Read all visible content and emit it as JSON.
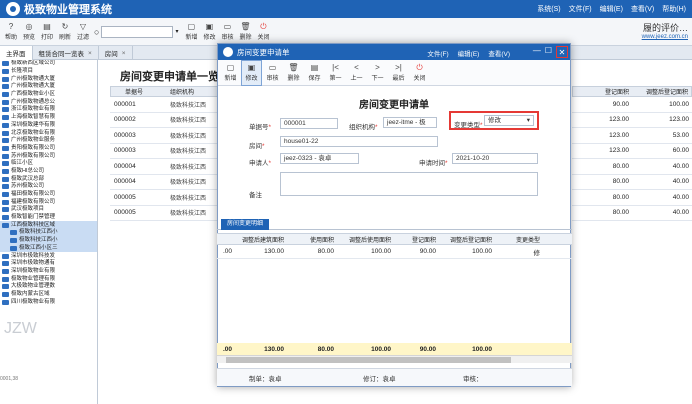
{
  "app": {
    "title": "极致物业管理系统",
    "menu": [
      "系统(S)",
      "文件(F)",
      "编辑(E)",
      "查看(V)",
      "帮助(H)"
    ]
  },
  "main_toolbar": [
    {
      "label": "帮助",
      "icon": "help-icon"
    },
    {
      "label": "预览",
      "icon": "preview-icon"
    },
    {
      "label": "打印",
      "icon": "print-icon"
    },
    {
      "label": "刷新",
      "icon": "refresh-icon"
    },
    {
      "label": "过滤",
      "icon": "filter-icon"
    }
  ],
  "main_toolbar2": [
    {
      "label": "新增",
      "icon": "new-icon"
    },
    {
      "label": "修改",
      "icon": "edit-icon"
    },
    {
      "label": "审核",
      "icon": "audit-icon"
    },
    {
      "label": "删除",
      "icon": "delete-icon"
    },
    {
      "label": "关闭",
      "icon": "power-icon"
    }
  ],
  "brand": {
    "line1": "履的评价…",
    "line2": "www.jeez.com.cn"
  },
  "tabs": [
    {
      "label": "主界面",
      "active": true
    },
    {
      "label": "租赁合同一览表",
      "active": false
    },
    {
      "label": "房间",
      "active": false
    }
  ],
  "sidebar": [
    "极致新西区域公司",
    "长隆项目",
    "广州极致物通大厦",
    "广州极致物通大厦",
    "广西极致物业小区",
    "广州极致物通总公",
    "浙江极致物业有限",
    "上海极致智慧有限",
    "深圳极致建华有限",
    "北京极致物业有限",
    "广州极致物业服务",
    "贵阳极致有限公司",
    "苏州极致有限公司",
    "临江小区",
    "极致HI总公司",
    "极致武汉总部",
    "苏州极致公司",
    "福田极致有限公司",
    "福建极致有限公司",
    "武汉极致项目",
    "极致智能门禁管理",
    "江西极致科技区域",
    "极致科技江西小",
    "极致科技江西小",
    "极致江西小区三",
    "深圳市极致科技发",
    "深圳市极致物通有",
    "深圳极致物业有限",
    "极致物业管理有限",
    "大极致物业管理数",
    "极致内蒙古区域",
    "四川极致物业有限"
  ],
  "bg": {
    "title": "房间变更申请单一览表",
    "col1": "单据号",
    "col2": "组织机构",
    "col3": "登记面积",
    "col4": "调整后登记面积",
    "rows": [
      {
        "no": "000001",
        "org": "极致科技江西",
        "area": "90.00",
        "adj": "100.00"
      },
      {
        "no": "000002",
        "org": "极致科技江西",
        "area": "123.00",
        "adj": "123.00"
      },
      {
        "no": "000003",
        "org": "极致科技江西",
        "area": "123.00",
        "adj": "53.00"
      },
      {
        "no": "000003",
        "org": "极致科技江西",
        "area": "123.00",
        "adj": "60.00"
      },
      {
        "no": "000004",
        "org": "极致科技江西",
        "area": "80.00",
        "adj": "40.00"
      },
      {
        "no": "000004",
        "org": "极致科技江西",
        "area": "80.00",
        "adj": "40.00"
      },
      {
        "no": "000005",
        "org": "极致科技江西",
        "area": "80.00",
        "adj": "40.00"
      },
      {
        "no": "000005",
        "org": "极致科技江西",
        "area": "80.00",
        "adj": "40.00"
      }
    ]
  },
  "watermark": "JZW",
  "footer": "0001,38",
  "dialog": {
    "title": "房间变更申请单",
    "menu": [
      "文件(F)",
      "编辑(E)",
      "查看(V)"
    ],
    "toolbar": [
      {
        "label": "新增",
        "icon": "new-icon"
      },
      {
        "label": "修改",
        "icon": "edit-icon"
      },
      {
        "label": "审核",
        "icon": "audit-icon"
      },
      {
        "label": "删除",
        "icon": "delete-icon"
      },
      {
        "label": "保存",
        "icon": "save-icon"
      },
      {
        "label": "第一",
        "icon": "first-icon"
      },
      {
        "label": "上一",
        "icon": "prev-icon"
      },
      {
        "label": "下一",
        "icon": "next-icon"
      },
      {
        "label": "最后",
        "icon": "last-icon"
      },
      {
        "label": "关闭",
        "icon": "power-icon"
      }
    ],
    "form_title": "房间变更申请单",
    "fields": {
      "doc_no_label": "单据号",
      "doc_no": "000001",
      "org_label": "组织机构",
      "org": "jeez-itme - 极",
      "change_type_label": "变更类型",
      "change_type": "修改",
      "room_label": "房间",
      "room": "house01-22",
      "applicant_label": "申请人",
      "applicant": "jeez-0323 - 袁卓",
      "apply_time_label": "申请时间",
      "apply_time": "2021-10-20",
      "remark_label": "备注"
    },
    "detail_tab": "房间变更明细",
    "grid_headers": [
      "调整后建筑面积",
      "使用面积",
      "调整后使用面积",
      "登记面积",
      "调整后登记面积",
      "变更类型"
    ],
    "grid_row": {
      "lead": ".00",
      "v1": "130.00",
      "v2": "80.00",
      "v3": "100.00",
      "v4": "90.00",
      "v5": "100.00",
      "v6": "修"
    },
    "grid_total": {
      "lead": ".00",
      "v1": "130.00",
      "v2": "80.00",
      "v3": "100.00",
      "v4": "90.00",
      "v5": "100.00"
    },
    "status": {
      "maker": "制单：袁卓",
      "modifier": "修订：袁卓",
      "auditor": "审核："
    }
  }
}
